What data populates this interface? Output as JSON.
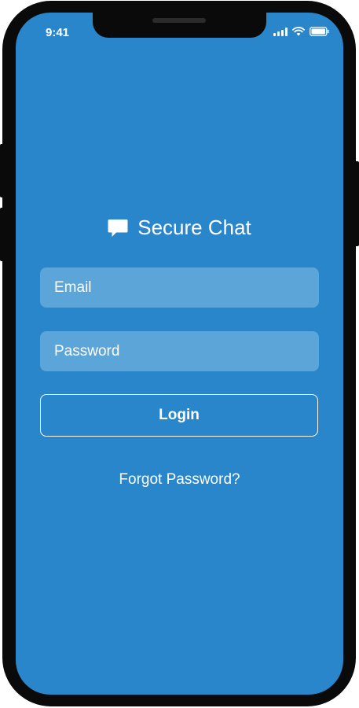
{
  "status_bar": {
    "time": "9:41",
    "signal_icon": "cellular-signal-icon",
    "wifi_icon": "wifi-icon",
    "battery_icon": "battery-icon"
  },
  "brand": {
    "icon": "chat-bubble-icon",
    "title": "Secure Chat"
  },
  "form": {
    "email_placeholder": "Email",
    "password_placeholder": "Password",
    "login_label": "Login",
    "forgot_label": "Forgot Password?"
  },
  "colors": {
    "screen_background": "#2a86cb",
    "field_background": "#5ca5d9",
    "text": "#ffffff"
  }
}
